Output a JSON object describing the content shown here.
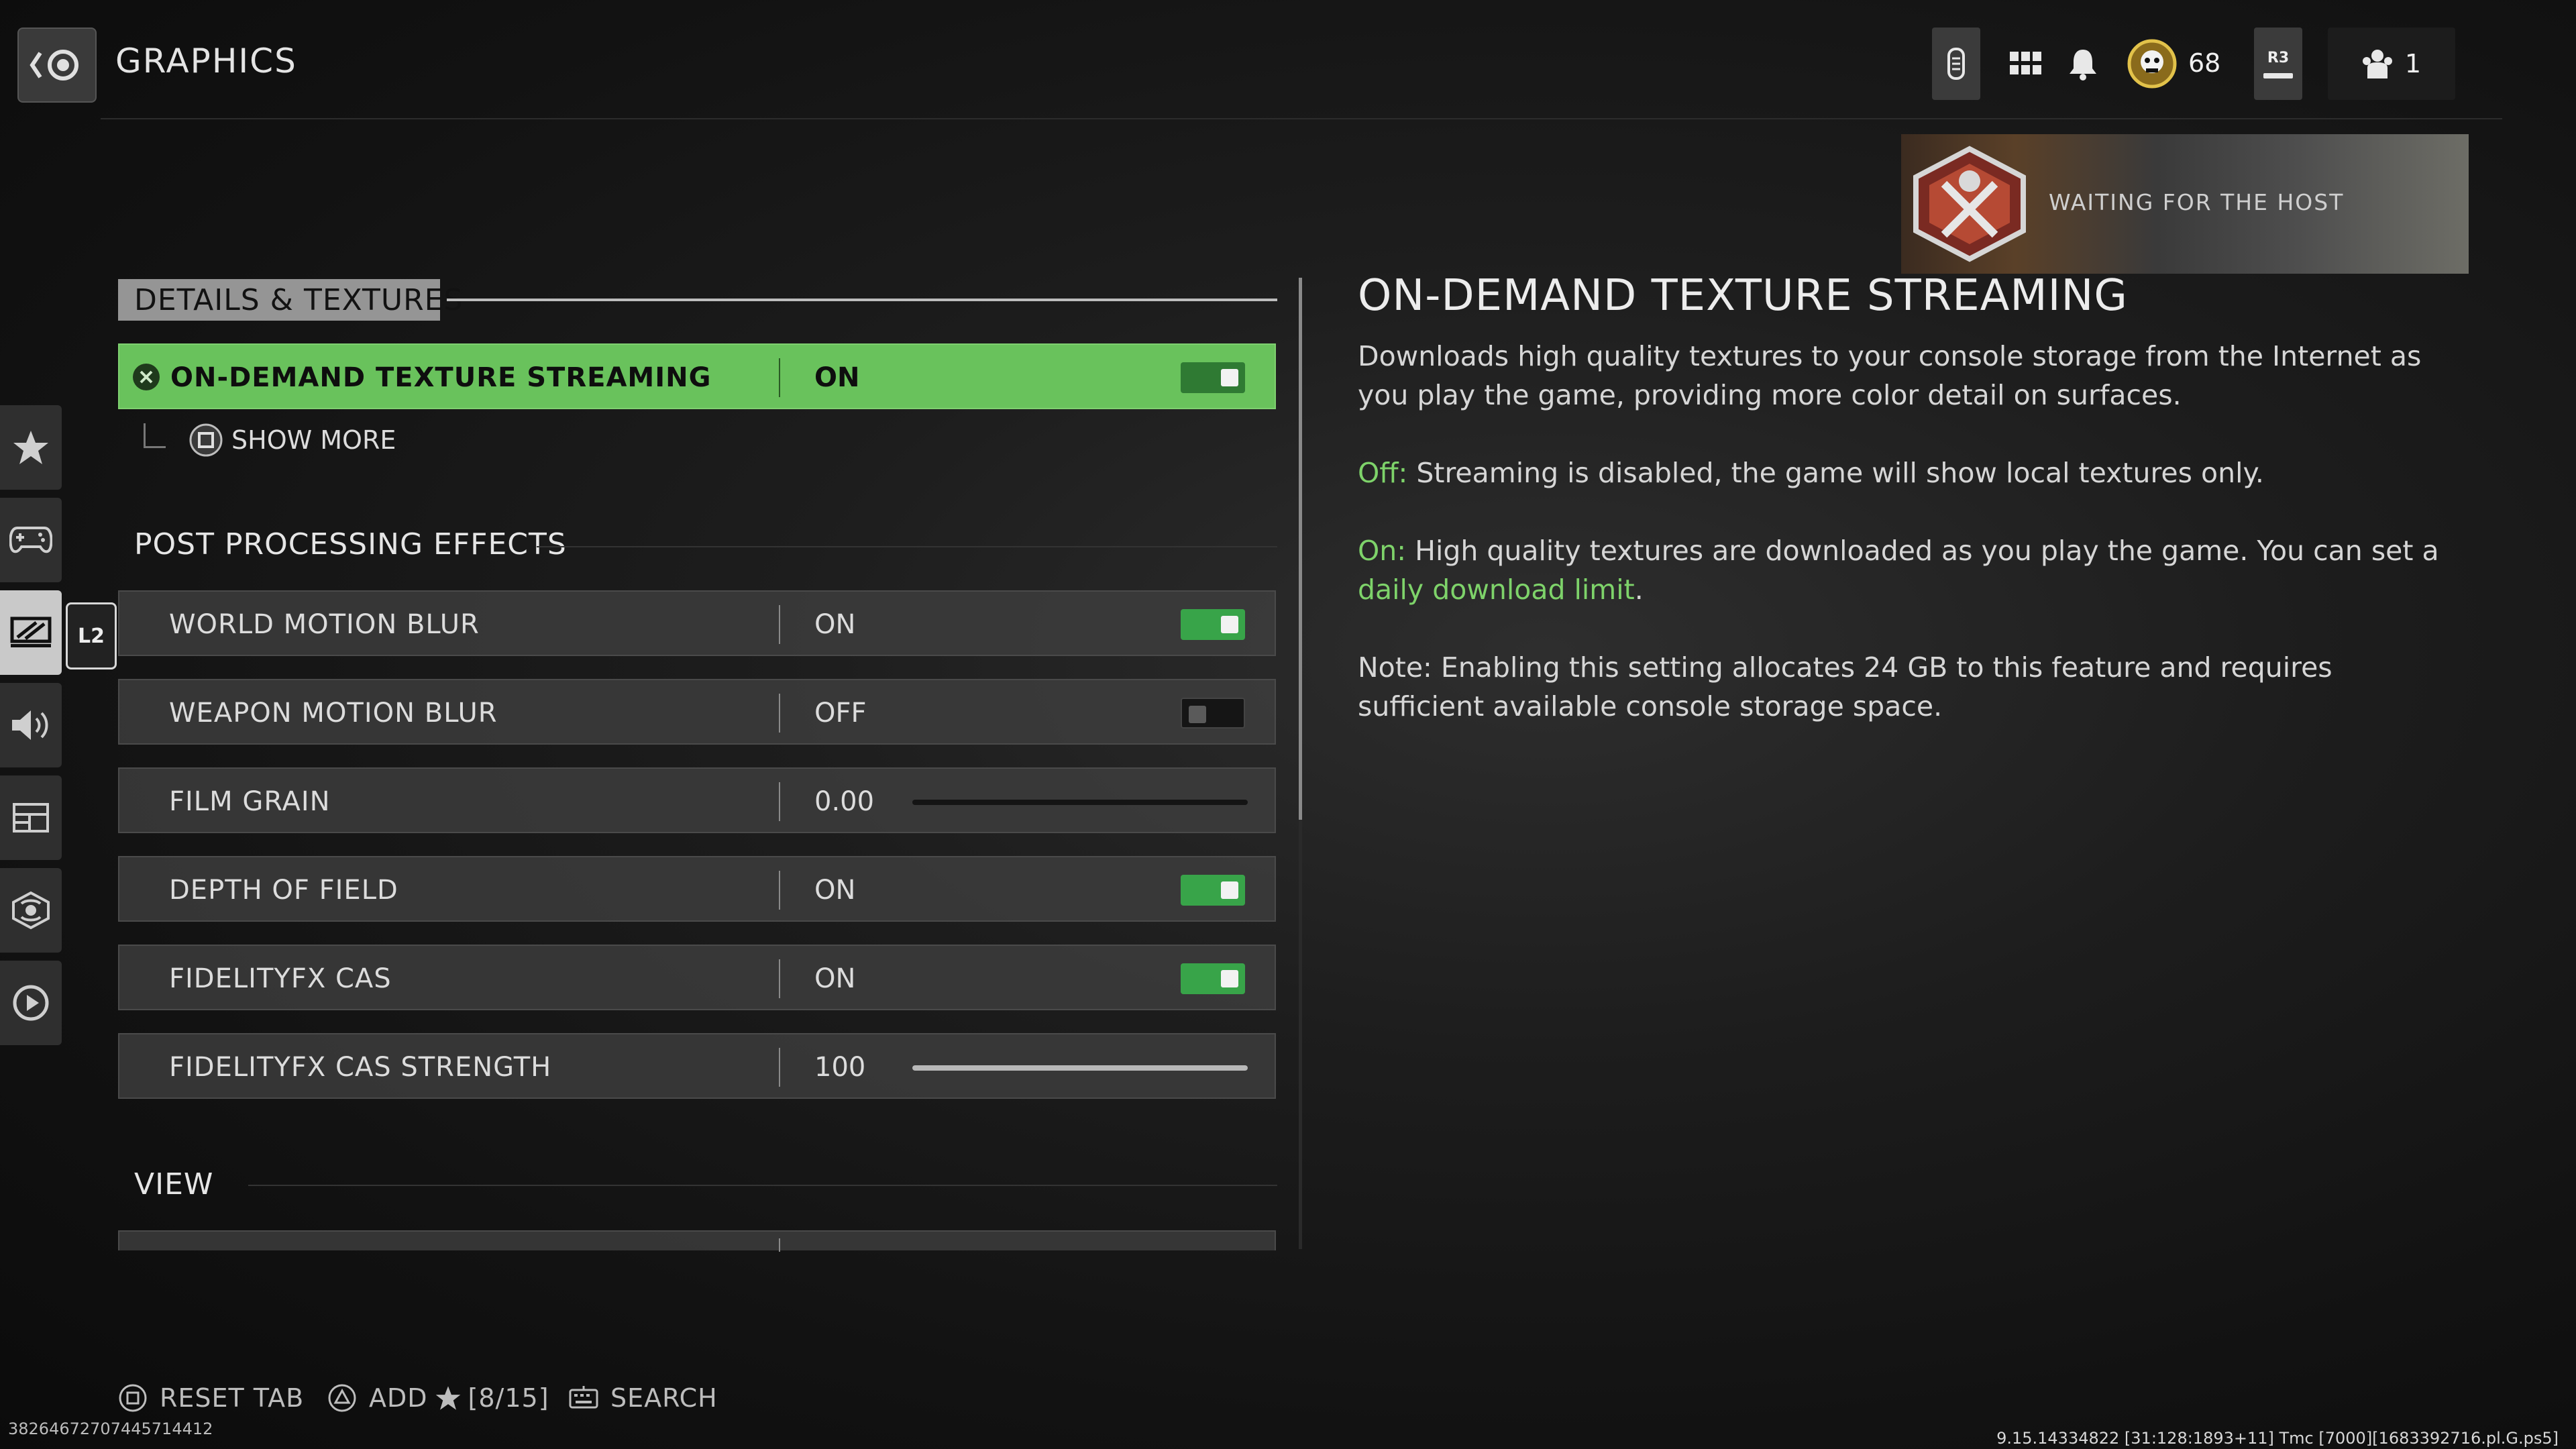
{
  "header": {
    "title": "GRAPHICS"
  },
  "hud": {
    "coin_count": "68",
    "r3_label": "R3",
    "party_count": "1"
  },
  "lobby": {
    "status": "WAITING FOR THE HOST"
  },
  "rail": {
    "l2_label": "L2"
  },
  "sections": {
    "details": "DETAILS & TEXTURES",
    "post": "POST PROCESSING EFFECTS",
    "view": "VIEW"
  },
  "show_more": "SHOW MORE",
  "settings": [
    {
      "label": "ON-DEMAND TEXTURE STREAMING",
      "value": "ON",
      "control": "toggle",
      "on": true
    },
    {
      "label": "WORLD MOTION BLUR",
      "value": "ON",
      "control": "toggle",
      "on": true
    },
    {
      "label": "WEAPON MOTION BLUR",
      "value": "OFF",
      "control": "toggle",
      "on": false
    },
    {
      "label": "FILM GRAIN",
      "value": "0.00",
      "control": "slider",
      "level": 0.0
    },
    {
      "label": "DEPTH OF FIELD",
      "value": "ON",
      "control": "toggle",
      "on": true
    },
    {
      "label": "FIDELITYFX CAS",
      "value": "ON",
      "control": "toggle",
      "on": true
    },
    {
      "label": "FIDELITYFX CAS STRENGTH",
      "value": "100",
      "control": "slider",
      "level": 1.0
    }
  ],
  "description": {
    "title": "ON-DEMAND TEXTURE STREAMING",
    "p1": "Downloads high quality textures to your console storage from the Internet as you play the game, providing more color detail on surfaces.",
    "p2_key": "Off:",
    "p2_text": " Streaming is disabled, the game will show local textures only.",
    "p3_key": "On:",
    "p3_text": " High quality textures are downloaded as you play the game. You can set a ",
    "p3_link": "daily download limit",
    "p3_end": ".",
    "p4": "Note: Enabling this setting allocates 24 GB to this feature and requires sufficient available console storage space."
  },
  "footer": {
    "reset": "RESET TAB",
    "add": "ADD",
    "add_count": "[8/15]",
    "search": "SEARCH",
    "id": "3826467270744571441​2",
    "build": "9.15.14334822 [31:128:1893+11] Tmc [7000][1683392716.pl.G.ps5]"
  },
  "colors": {
    "accent_green": "#69c25c",
    "toggle_on": "#38a449",
    "text_green": "#7ed36a"
  },
  "icons": [
    "back-icon",
    "mic-icon",
    "apps-grid-icon",
    "bell-icon",
    "coin-icon",
    "r3-icon",
    "party-icon",
    "star-icon",
    "controller-icon",
    "display-icon",
    "speaker-icon",
    "interface-icon",
    "network-icon",
    "replay-icon",
    "x-button-icon",
    "square-button-icon",
    "triangle-button-icon",
    "keyboard-icon"
  ]
}
